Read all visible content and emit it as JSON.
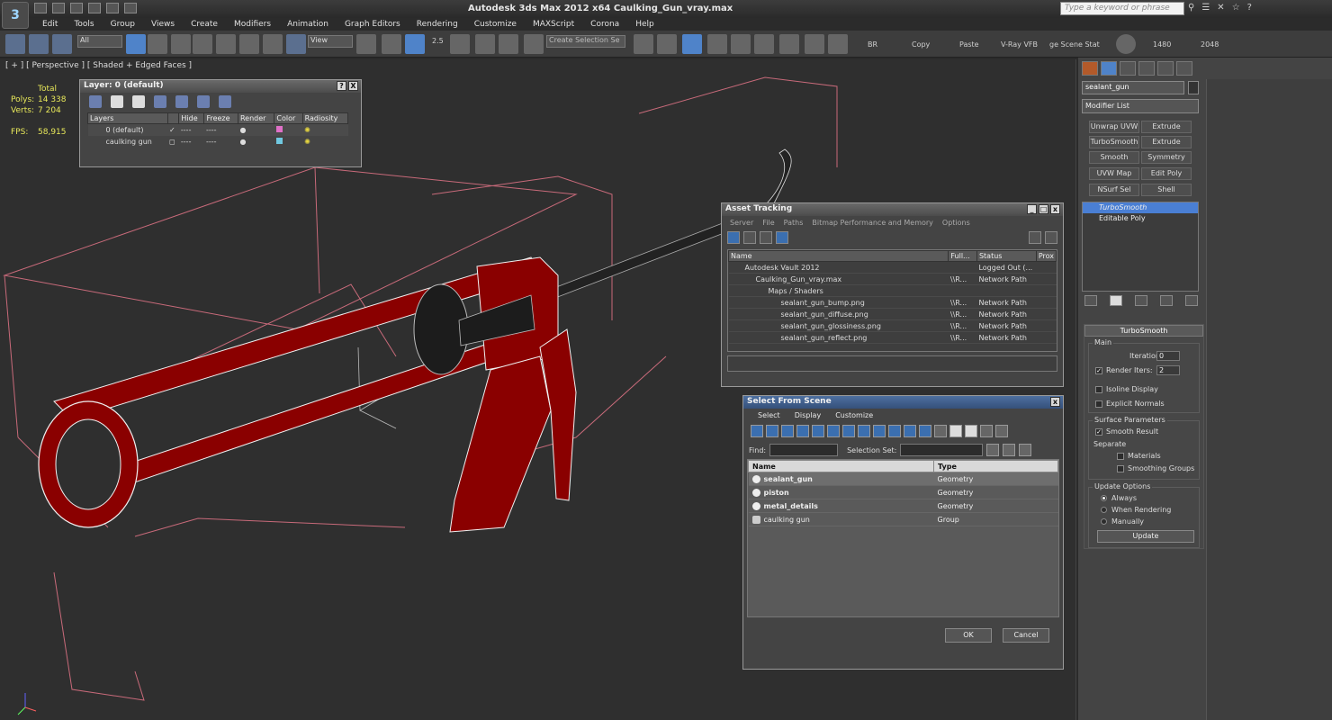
{
  "title": {
    "text": "Autodesk 3ds Max  2012 x64     Caulking_Gun_vray.max",
    "search_placeholder": "Type a keyword or phrase",
    "logo": "3ds-max-logo"
  },
  "menu": [
    "Edit",
    "Tools",
    "Group",
    "Views",
    "Create",
    "Modifiers",
    "Animation",
    "Graph Editors",
    "Rendering",
    "Customize",
    "MAXScript",
    "Corona",
    "Help"
  ],
  "toolbar": {
    "filter_value": "All",
    "refcoord_value": "View",
    "selection_set_placeholder": "Create Selection Se",
    "br_label": "BR",
    "copy_label": "Copy",
    "paste_label": "Paste",
    "vray_vfb_label": "V-Ray VFB",
    "scene_state_label": "ge Scene Stat",
    "width_label": "1480",
    "height_label": "2048",
    "snap_value": "2.5"
  },
  "viewport": {
    "label": "[ + ] [ Perspective ] [ Shaded + Edged Faces ]",
    "stats": {
      "total_label": "Total",
      "polys_label": "Polys:",
      "polys_value": "14 338",
      "verts_label": "Verts:",
      "verts_value": "7 204",
      "fps_label": "FPS:",
      "fps_value": "58,915"
    },
    "colors": {
      "model_fill": "#8a0000",
      "bbox_line": "#c86a7a",
      "wire": "#f0f0f0"
    }
  },
  "layer_window": {
    "title": "Layer: 0 (default)",
    "help": "?",
    "close": "X",
    "columns": [
      "Layers",
      "",
      "Hide",
      "Freeze",
      "Render",
      "Color",
      "Radiosity"
    ],
    "rows": [
      {
        "name": "0 (default)",
        "check": "✓",
        "hide": "----",
        "freeze": "----",
        "color": "#e070c8"
      },
      {
        "name": "caulking gun",
        "check": "",
        "hide": "----",
        "freeze": "----",
        "color": "#70c8e0"
      }
    ]
  },
  "asset_window": {
    "title": "Asset Tracking",
    "menu": [
      "Server",
      "File",
      "Paths",
      "Bitmap Performance and Memory",
      "Options"
    ],
    "columns": [
      "Name",
      "Full...",
      "Status",
      "Prox"
    ],
    "rows": [
      {
        "name": "Autodesk Vault 2012",
        "full": "",
        "status": "Logged Out (...",
        "indent": 1
      },
      {
        "name": "Caulking_Gun_vray.max",
        "full": "\\\\R...",
        "status": "Network Path",
        "indent": 2
      },
      {
        "name": "Maps / Shaders",
        "full": "",
        "status": "",
        "indent": 3
      },
      {
        "name": "sealant_gun_bump.png",
        "full": "\\\\R...",
        "status": "Network Path",
        "indent": 4
      },
      {
        "name": "sealant_gun_diffuse.png",
        "full": "\\\\R...",
        "status": "Network Path",
        "indent": 4
      },
      {
        "name": "sealant_gun_glossiness.png",
        "full": "\\\\R...",
        "status": "Network Path",
        "indent": 4
      },
      {
        "name": "sealant_gun_reflect.png",
        "full": "\\\\R...",
        "status": "Network Path",
        "indent": 4
      }
    ]
  },
  "sfs_window": {
    "title": "Select From Scene",
    "menu": [
      "Select",
      "Display",
      "Customize"
    ],
    "find_label": "Find:",
    "selset_label": "Selection Set:",
    "columns": [
      "Name",
      "Type"
    ],
    "rows": [
      {
        "name": "sealant_gun",
        "type": "Geometry",
        "selected": true,
        "bold": true
      },
      {
        "name": "piston",
        "type": "Geometry",
        "selected": false,
        "bold": true
      },
      {
        "name": "metal_details",
        "type": "Geometry",
        "selected": false,
        "bold": true
      },
      {
        "name": "caulking gun",
        "type": "Group",
        "selected": false,
        "bold": false
      }
    ],
    "ok": "OK",
    "cancel": "Cancel"
  },
  "command_panel": {
    "object_name": "sealant_gun",
    "modifier_list": "Modifier List",
    "modifier_buttons": [
      "Unwrap UVW",
      "Extrude",
      "TurboSmooth",
      "Extrude",
      "Smooth",
      "Symmetry",
      "UVW Map",
      "Edit Poly",
      "NSurf Sel",
      "Shell"
    ],
    "stack": [
      "TurboSmooth",
      "Editable Poly"
    ],
    "turbosmooth": {
      "header": "TurboSmooth",
      "main": "Main",
      "iterations_label": "Iterations:",
      "iterations_value": "0",
      "render_iters_label": "Render Iters:",
      "render_iters_value": "2",
      "isoline": "Isoline Display",
      "explicit": "Explicit Normals",
      "surface": "Surface Parameters",
      "smooth_result": "Smooth Result",
      "separate": "Separate",
      "materials": "Materials",
      "smoothing_groups": "Smoothing Groups",
      "update_options": "Update Options",
      "always": "Always",
      "when_rendering": "When Rendering",
      "manually": "Manually",
      "update": "Update"
    }
  }
}
